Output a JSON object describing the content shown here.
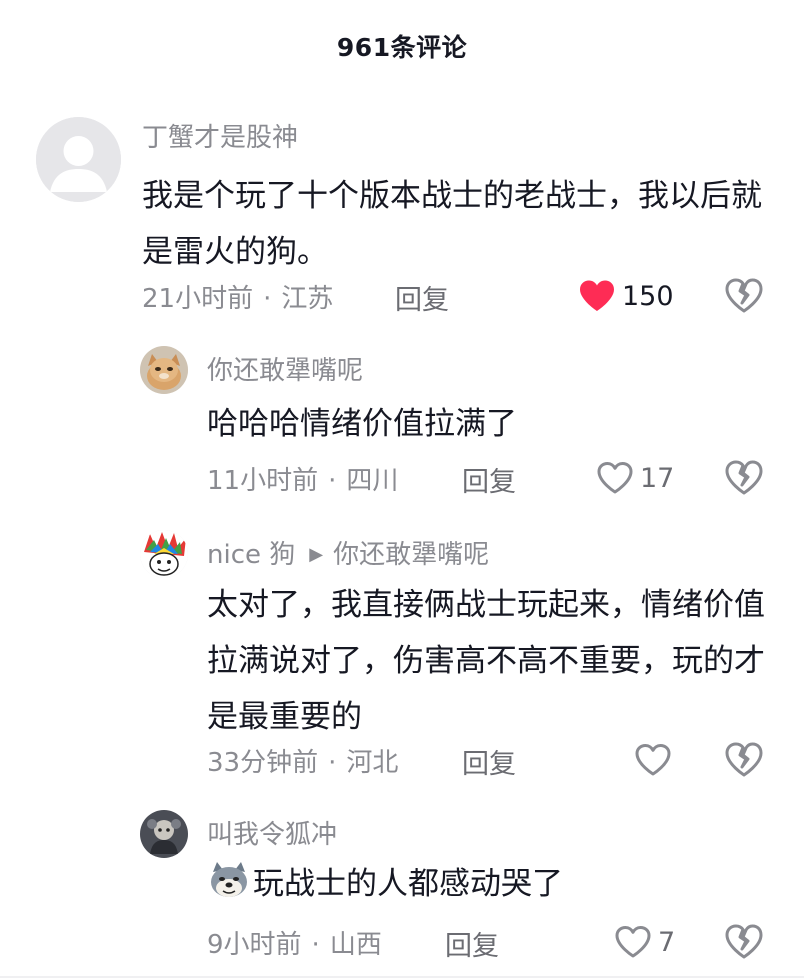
{
  "header": {
    "title": "961条评论"
  },
  "comments": [
    {
      "username": "丁蟹才是股神",
      "text": "我是个玩了十个版本战士的老战士，我以后就是雷火的狗。",
      "time": "21小时前",
      "location": "江苏",
      "reply_label": "回复",
      "likes": "150",
      "liked": true,
      "avatar": "default-avatar-icon"
    },
    {
      "username": "你还敢犟嘴呢",
      "text": "哈哈哈情绪价值拉满了",
      "time": "11小时前",
      "location": "四川",
      "reply_label": "回复",
      "likes": "17",
      "liked": false,
      "avatar": "cat-avatar"
    },
    {
      "username": "nice 狗",
      "reply_to": "你还敢犟嘴呢",
      "text": "太对了，我直接俩战士玩起来，情绪价值拉满说对了，伤害高不高不重要，玩的才是最重要的",
      "time": "33分钟前",
      "location": "河北",
      "reply_label": "回复",
      "likes": "",
      "liked": false,
      "avatar": "colorful-avatar"
    },
    {
      "username": "叫我令狐冲",
      "text": "玩战士的人都感动哭了",
      "time": "9小时前",
      "location": "山西",
      "reply_label": "回复",
      "likes": "7",
      "liked": false,
      "avatar": "dark-avatar",
      "emoji": "doge-emoji-icon"
    }
  ],
  "colors": {
    "like_red": "#fe2c55",
    "meta_gray": "#8a8b91",
    "text": "#161823"
  }
}
